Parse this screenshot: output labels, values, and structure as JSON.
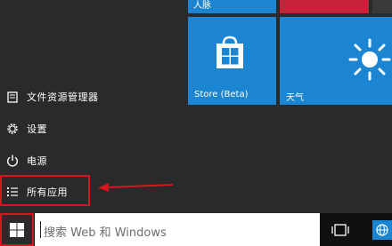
{
  "left_menu": {
    "file_explorer": "文件资源管理器",
    "settings": "设置",
    "power": "电源",
    "all_apps": "所有应用"
  },
  "tiles": {
    "top_left_label": "人脉",
    "store_label": "Store (Beta)",
    "weather_label": "天气"
  },
  "taskbar": {
    "search_placeholder": "搜索 Web 和 Windows"
  },
  "colors": {
    "accent_blue": "#1c85d2",
    "highlight_red": "#d7151e",
    "people_tile_red": "#c8223b"
  }
}
